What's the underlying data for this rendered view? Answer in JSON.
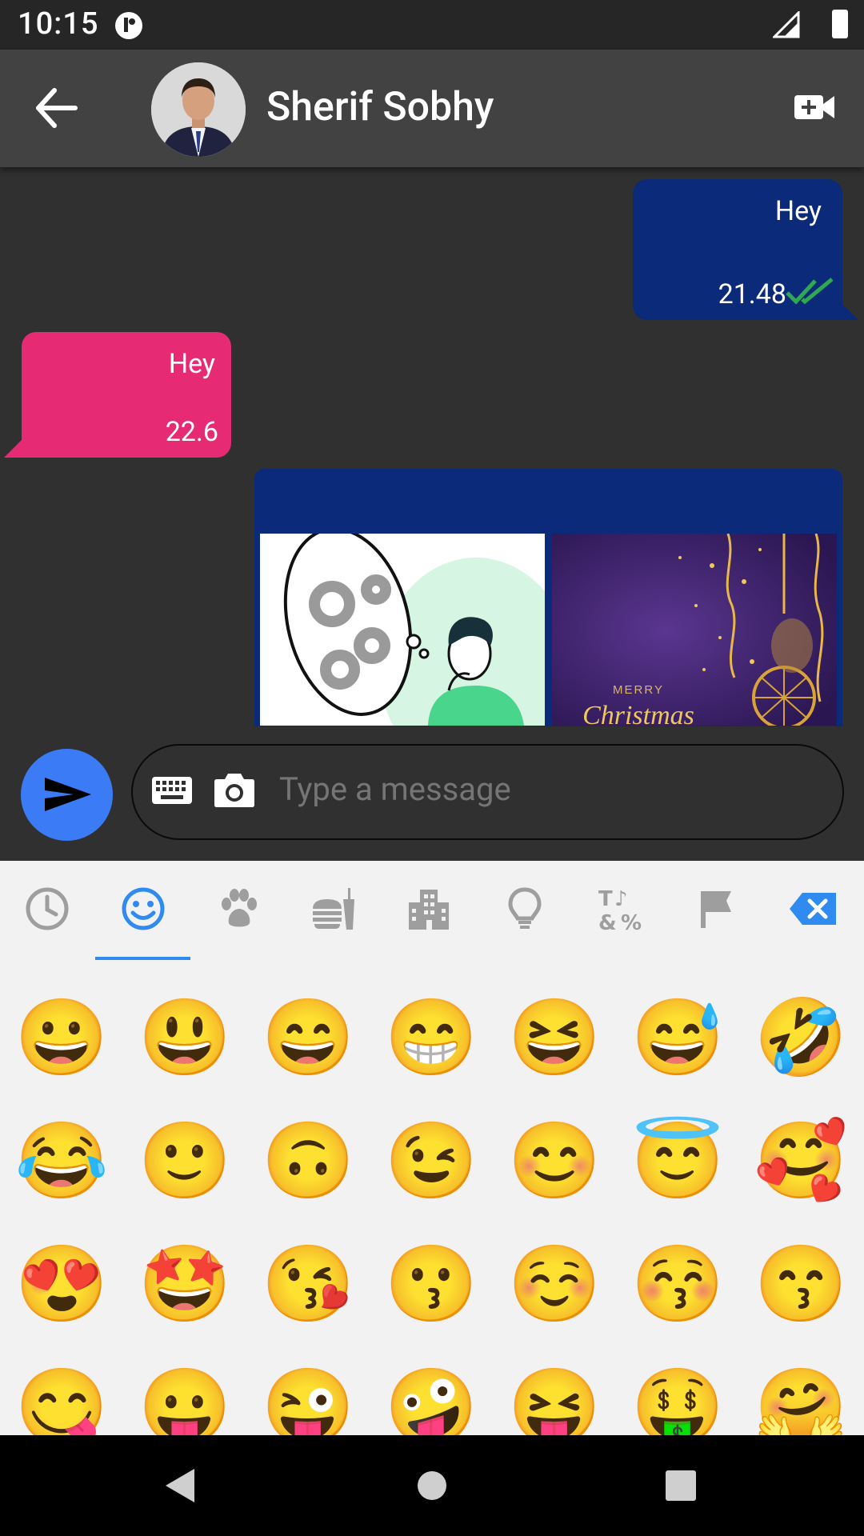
{
  "status_bar": {
    "time": "10:15"
  },
  "header": {
    "contact_name": "Sherif Sobhy"
  },
  "messages": [
    {
      "direction": "sent",
      "text": "Hey",
      "time": "21.48"
    },
    {
      "direction": "received",
      "text": "Hey",
      "time": "22.6"
    }
  ],
  "image_message": {
    "images": [
      "thought-illustration",
      "merry-christmas"
    ],
    "christmas_text": "MERRY",
    "christmas_script": "Christmas"
  },
  "input": {
    "placeholder": "Type a message"
  },
  "emoji_tabs": [
    "recent",
    "smileys",
    "animals",
    "food",
    "travel",
    "objects",
    "symbols",
    "flags"
  ],
  "emoji_grid": [
    [
      "😀",
      "😃",
      "😄",
      "😁",
      "😆",
      "😅",
      "🤣"
    ],
    [
      "😂",
      "🙂",
      "🙃",
      "😉",
      "😊",
      "😇",
      "🥰"
    ],
    [
      "😍",
      "🤩",
      "😘",
      "😗",
      "☺️",
      "😚",
      "😙"
    ],
    [
      "😋",
      "😛",
      "😜",
      "🤪",
      "😝",
      "🤑",
      "🤗"
    ]
  ],
  "colors": {
    "sent_bubble": "#0b2a7a",
    "received_bubble": "#e62a74",
    "accent": "#3b7cf6",
    "indicator": "#2f8bf0",
    "read_check": "#2fa84f"
  }
}
